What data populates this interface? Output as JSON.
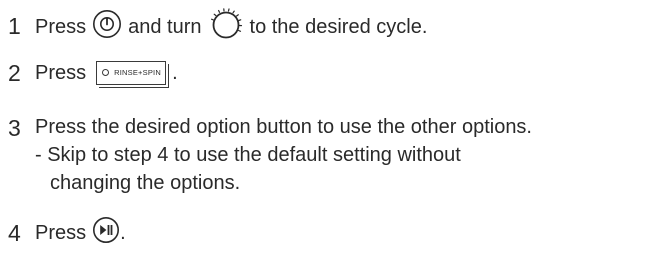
{
  "steps": [
    {
      "number": "1",
      "text_a": "Press",
      "icon_a": "power-button-icon",
      "text_b": "and turn",
      "icon_b": "cycle-dial-icon",
      "text_c": "to the desired cycle."
    },
    {
      "number": "2",
      "text_a": "Press",
      "button_label": "RINSE+SPIN",
      "text_b": "."
    },
    {
      "number": "3",
      "text_a": "Press the desired option button to use the other options.",
      "sub_line_1": "- Skip to step 4 to use the default setting without",
      "sub_line_2": "changing the options."
    },
    {
      "number": "4",
      "text_a": "Press",
      "icon_a": "start-pause-button-icon",
      "text_b": "."
    }
  ]
}
